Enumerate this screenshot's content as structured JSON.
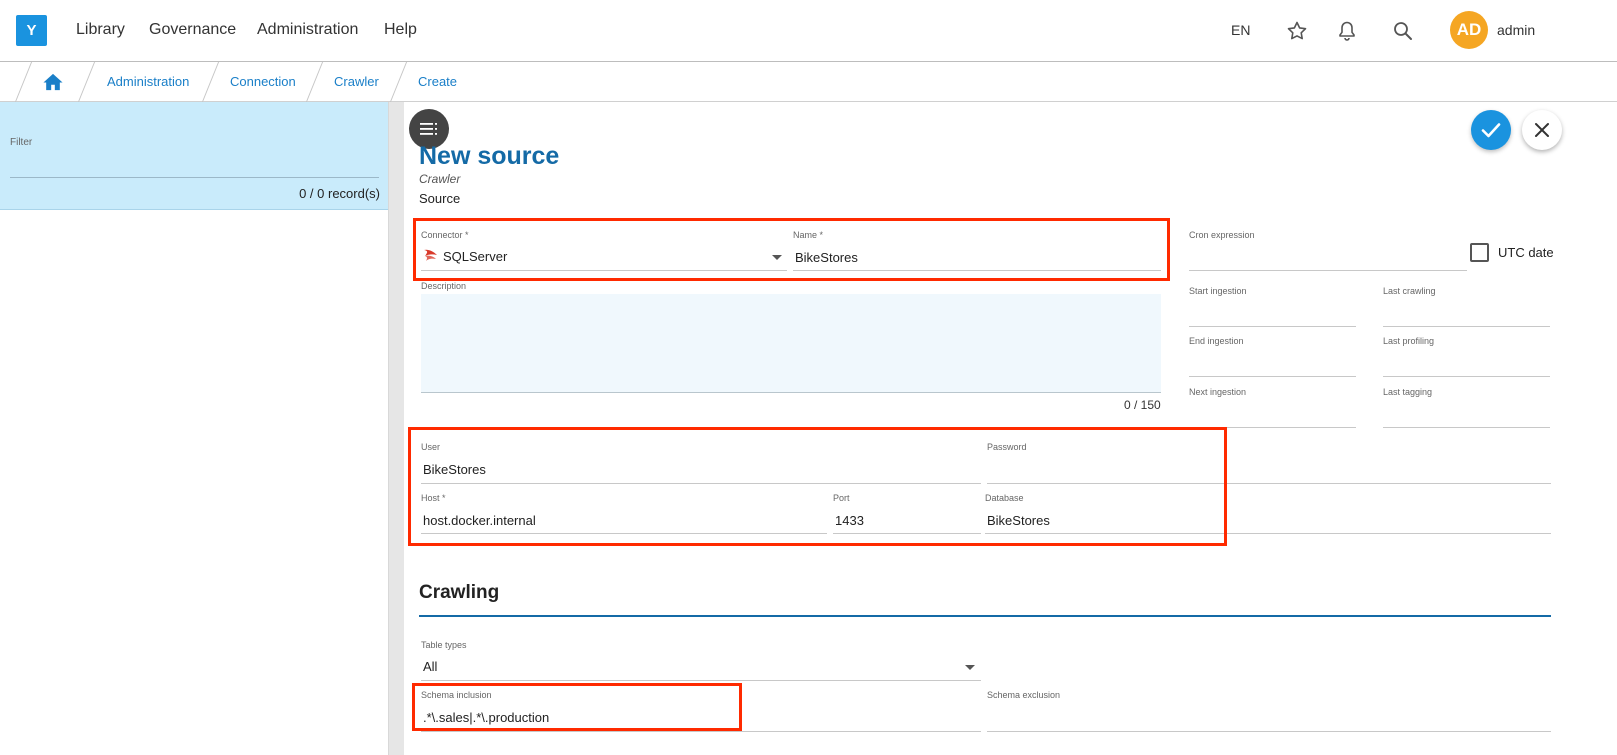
{
  "app": {
    "logo_letter": "Y"
  },
  "nav": {
    "items": [
      "Library",
      "Governance",
      "Administration",
      "Help"
    ]
  },
  "topbar": {
    "lang": "EN",
    "avatar_initials": "AD",
    "username": "admin"
  },
  "breadcrumb": [
    "Administration",
    "Connection",
    "Crawler",
    "Create"
  ],
  "left_panel": {
    "filter_label": "Filter",
    "records": "0 / 0 record(s)"
  },
  "form": {
    "title": "New source",
    "subtitle": "Crawler",
    "section": "Source",
    "connector": {
      "label": "Connector *",
      "value": "SQLServer"
    },
    "name": {
      "label": "Name *",
      "value": "BikeStores"
    },
    "description": {
      "label": "Description",
      "count": "0 / 150"
    },
    "cron": {
      "label": "Cron expression"
    },
    "utc": {
      "label": "UTC date"
    },
    "start_ingestion": {
      "label": "Start ingestion"
    },
    "last_crawling": {
      "label": "Last crawling"
    },
    "end_ingestion": {
      "label": "End ingestion"
    },
    "last_profiling": {
      "label": "Last profiling"
    },
    "next_ingestion": {
      "label": "Next ingestion"
    },
    "last_tagging": {
      "label": "Last tagging"
    },
    "user": {
      "label": "User",
      "value": "BikeStores"
    },
    "password": {
      "label": "Password"
    },
    "host": {
      "label": "Host *",
      "value": "host.docker.internal"
    },
    "port": {
      "label": "Port",
      "value": "1433"
    },
    "database": {
      "label": "Database",
      "value": "BikeStores"
    },
    "crawling_title": "Crawling",
    "table_types": {
      "label": "Table types",
      "value": "All"
    },
    "schema_inclusion": {
      "label": "Schema inclusion",
      "value": ".*\\.sales|.*\\.production"
    },
    "schema_exclusion": {
      "label": "Schema exclusion"
    }
  },
  "colors": {
    "accent": "#1a93df",
    "title_blue": "#146aa6",
    "highlight_red": "#ff2a00",
    "filter_bg": "#c9ebfb",
    "avatar": "#f5a623"
  },
  "icons": [
    "home-icon",
    "star-icon",
    "bell-icon",
    "search-icon",
    "menu-icon",
    "check-icon",
    "close-icon",
    "sqlserver-icon",
    "chevron-down-icon"
  ]
}
